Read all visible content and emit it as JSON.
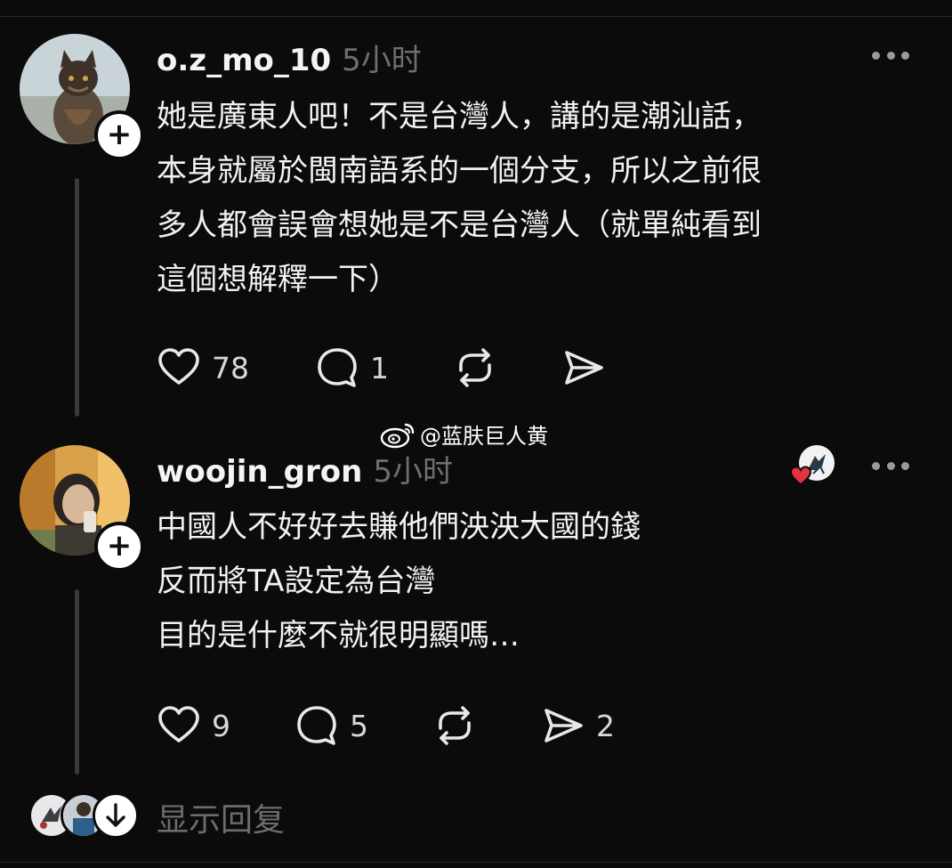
{
  "watermark": {
    "text": "@蓝肤巨人黄",
    "logo_icon": "weibo-icon"
  },
  "posts": [
    {
      "username": "o.z_mo_10",
      "time": "5小时",
      "lines": [
        "她是廣東人吧！不是台灣人，講的是潮汕話，",
        "本身就屬於閩南語系的一個分支，所以之前很",
        "多人都會誤會想她是不是台灣人（就單純看到",
        "這個想解釋一下）"
      ],
      "likes": "78",
      "comments": "1",
      "reposts": "",
      "shares": ""
    },
    {
      "username": "woojin_gron",
      "time": "5小时",
      "lines": [
        "中國人不好好去賺他們泱泱大國的錢",
        "反而將TA設定為台灣",
        "目的是什麼不就很明顯嗎…"
      ],
      "likes": "9",
      "comments": "5",
      "reposts": "",
      "shares": "2"
    }
  ],
  "footer": {
    "show_replies": "显示回复"
  },
  "colors": {
    "background": "#0b0b0b",
    "text": "#f2f2f2",
    "muted": "#6f6f6f",
    "heart_red": "#e8313f"
  }
}
